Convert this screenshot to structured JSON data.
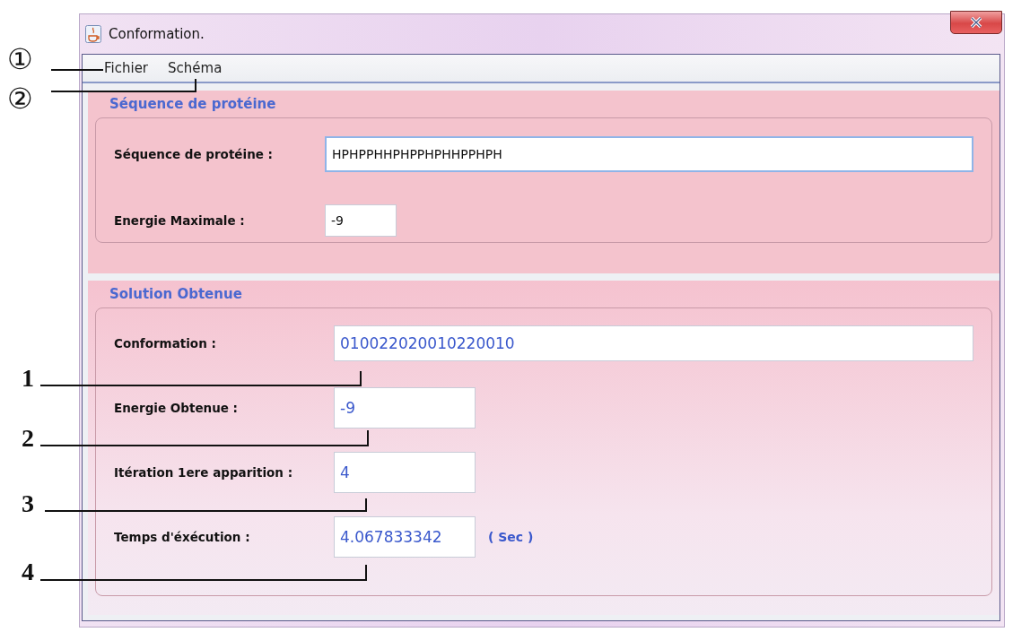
{
  "window": {
    "title": "Conformation."
  },
  "menu": [
    {
      "label": "Fichier"
    },
    {
      "label": "Schéma"
    }
  ],
  "sections": [
    {
      "title": "Séquence de protéine",
      "kind": "input",
      "fields": [
        {
          "label": "Séquence de protéine :",
          "value": "HPHPPHHPHPPHPHHPPHPH",
          "kind": "wide"
        },
        {
          "label": "Energie Maximale :",
          "value": "-9",
          "kind": "small"
        }
      ]
    },
    {
      "title": "Solution Obtenue",
      "kind": "output",
      "fields": [
        {
          "label": "Conformation :",
          "value": "010022020010220010",
          "kind": "wide"
        },
        {
          "label": "Energie Obtenue :",
          "value": "-9",
          "kind": "medium"
        },
        {
          "label": "Itération 1ere apparition :",
          "value": "4",
          "kind": "medium"
        },
        {
          "label": "Temps d'éxécution :",
          "value": "4.067833342",
          "kind": "medium",
          "unit": "( Sec )"
        }
      ]
    }
  ],
  "annotations": [
    {
      "label": "①"
    },
    {
      "label": "②"
    },
    {
      "label": "1"
    },
    {
      "label": "2"
    },
    {
      "label": "3"
    },
    {
      "label": "4"
    }
  ]
}
